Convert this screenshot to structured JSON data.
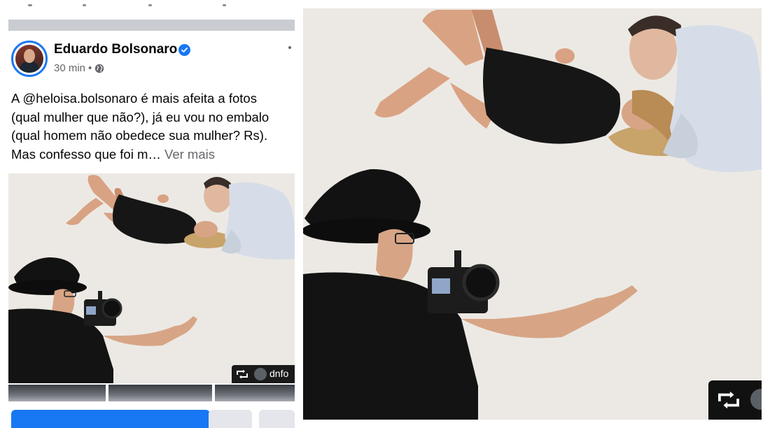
{
  "post": {
    "author": "Eduardo Bolsonaro",
    "time": "30 min",
    "separator": "•",
    "text_lines": [
      "A @heloisa.bolsonaro é mais afeita a fotos",
      "(qual mulher que não?), já eu vou no embalo",
      "(qual homem não obedece sua mulher? Rs).",
      "Mas confesso que foi m…"
    ],
    "see_more": "Ver mais",
    "repost_handle": "dnfo"
  },
  "icons": {
    "verified": "verified-badge-icon",
    "globe": "globe-icon",
    "more": "more-options-icon",
    "repost": "repost-icon"
  },
  "colors": {
    "facebook_blue": "#1877f2",
    "studio_backdrop": "#ece9e4"
  }
}
